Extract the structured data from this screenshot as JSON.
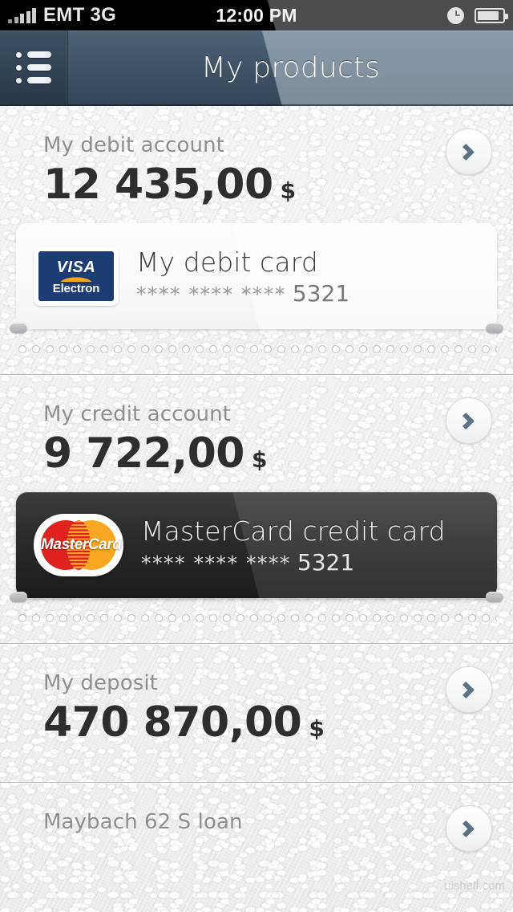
{
  "status_bar": {
    "signal_icon": "signal-bars-icon",
    "carrier": "EMT 3G",
    "time": "12:00 PM",
    "clock_icon": "clock-icon",
    "battery_icon": "battery-icon"
  },
  "navbar": {
    "menu_icon": "list-menu-icon",
    "title": "My products",
    "background_color": "#44576a"
  },
  "accounts": [
    {
      "label": "My debit account",
      "amount": "12 435,00",
      "currency": "$",
      "chevron_icon": "chevron-right-icon",
      "card": {
        "brand": "visa-electron",
        "brand_line1": "VISA",
        "brand_line2": "Electron",
        "title": "My debit card",
        "masked_number": "**** **** ****",
        "last4": "5321",
        "theme": "light"
      }
    },
    {
      "label": "My credit account",
      "amount": "9 722,00",
      "currency": "$",
      "chevron_icon": "chevron-right-icon",
      "card": {
        "brand": "mastercard",
        "brand_word": "MasterCard",
        "title": "MasterCard credit card",
        "masked_number": "**** **** ****",
        "last4": "5321",
        "theme": "dark"
      }
    },
    {
      "label": "My deposit",
      "amount": "470 870,00",
      "currency": "$",
      "chevron_icon": "chevron-right-icon",
      "card": null
    },
    {
      "label": "Maybach 62 S loan",
      "amount": "",
      "currency": "",
      "chevron_icon": "chevron-right-icon",
      "card": null
    }
  ],
  "watermark": "uishelf.com",
  "colors": {
    "navbar": "#44576a",
    "background": "#ededee",
    "amount_text": "#2e2e30",
    "label_text": "#8c8e90",
    "chevron": "#5c7183",
    "visa_blue": "#1b3d74",
    "visa_gold": "#f6a81c",
    "mastercard_red": "#e0231f",
    "mastercard_orange": "#f7a823",
    "dark_card": "#2a2a2a"
  }
}
